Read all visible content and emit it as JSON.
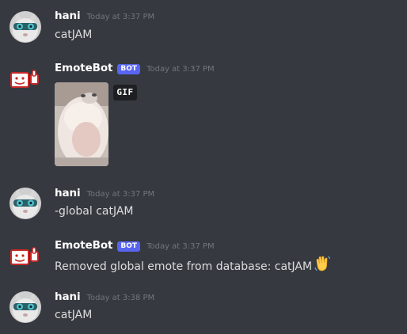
{
  "theme": {
    "background": "#36393f",
    "username_color": "#ffffff",
    "text_color": "#dcddde",
    "timestamp_color": "#72767d",
    "bot_tag_color": "#5865f2"
  },
  "messages": [
    {
      "author": "hani",
      "avatar_icon": "cat-goggles-avatar-icon",
      "is_bot": false,
      "timestamp": "Today at 3:37 PM",
      "text": "catJAM"
    },
    {
      "author": "EmoteBot",
      "avatar_icon": "emotebot-avatar-icon",
      "is_bot": true,
      "bot_tag": "BOT",
      "timestamp": "Today at 3:37 PM",
      "attachment": {
        "type": "gif",
        "badge": "GIF",
        "description_icon": "cat-gif-image"
      }
    },
    {
      "author": "hani",
      "avatar_icon": "cat-goggles-avatar-icon",
      "is_bot": false,
      "timestamp": "Today at 3:37 PM",
      "text": "-global catJAM"
    },
    {
      "author": "EmoteBot",
      "avatar_icon": "emotebot-avatar-icon",
      "is_bot": true,
      "bot_tag": "BOT",
      "timestamp": "Today at 3:37 PM",
      "text": "Removed global emote from database: catJAM",
      "emoji_icon": "waving-hand-emoji-icon"
    },
    {
      "author": "hani",
      "avatar_icon": "cat-goggles-avatar-icon",
      "is_bot": false,
      "timestamp": "Today at 3:38 PM",
      "text": "catJAM"
    }
  ]
}
